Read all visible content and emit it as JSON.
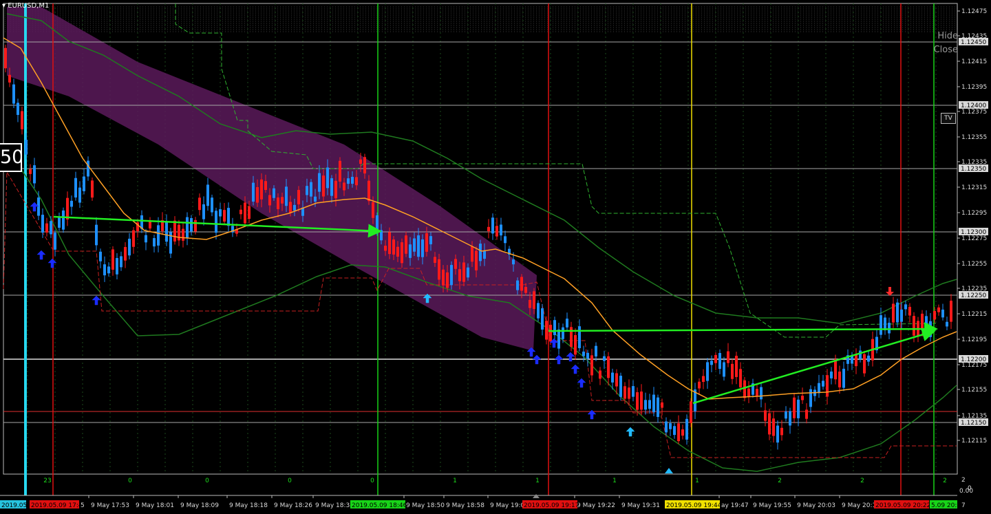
{
  "symbol": "EURUSD,M1",
  "controls": {
    "hide_label": "Hide",
    "close_label": "Close",
    "tv_label": "TV"
  },
  "overlay_counter": "50",
  "price_axis": {
    "ticks": [
      "1.12475",
      "1.12435",
      "1.12415",
      "1.12395",
      "1.12375",
      "1.12355",
      "1.12335",
      "1.12315",
      "1.12295",
      "1.12275",
      "1.12255",
      "1.12235",
      "1.12215",
      "1.12195",
      "1.12175",
      "1.12155",
      "1.12135",
      "1.12115"
    ],
    "boxed_levels": [
      "1.12450",
      "1.12400",
      "1.12350",
      "1.12300",
      "1.12250",
      "1.12200",
      "1.12150"
    ]
  },
  "time_axis": {
    "labels": [
      "9 May 17:53",
      "9 May 18:01",
      "9 May 18:09",
      "9 May 18:18",
      "9 May 18:26",
      "9 May 18:34",
      "9 May 18:50",
      "9 May 18:58",
      "9 May 19:0",
      "9 May 19:22",
      "9 May 19:31",
      "ay 19:47",
      "9 May 19:55",
      "9 May 20:03",
      "9 May 20:1"
    ],
    "highlight_labels": [
      {
        "text": "2019.05.",
        "color": "#27c4e0"
      },
      {
        "text": "2019.05.09 17:46",
        "color": "#e01010"
      },
      {
        "text": "2019.05.09 18:46",
        "color": "#18d418"
      },
      {
        "text": "2019.05.09 19:17",
        "color": "#e01010"
      },
      {
        "text": "2019.05.09 19:44",
        "color": "#f0e000"
      },
      {
        "text": "2019.05.09 20:22",
        "color": "#e01010"
      },
      {
        "text": "5.09 20:28",
        "color": "#18d418"
      }
    ],
    "fragments": [
      "5",
      "7"
    ]
  },
  "counter_row": [
    "23",
    "0",
    "0",
    "0",
    "0",
    "1",
    "1",
    "1",
    "1",
    "2",
    "2",
    "2"
  ],
  "bottom_right_labels": [
    "2",
    "0.00",
    "0"
  ],
  "colors": {
    "bull": "#1e90ff",
    "bear": "#ff1a1a",
    "ma": "#ffa024",
    "band": "#1f7a1f",
    "trend": "#22ee22",
    "channel": "#5a1a5a",
    "arrow_blue": "#1a2cff",
    "arrow_cyan": "#22bbff"
  }
}
